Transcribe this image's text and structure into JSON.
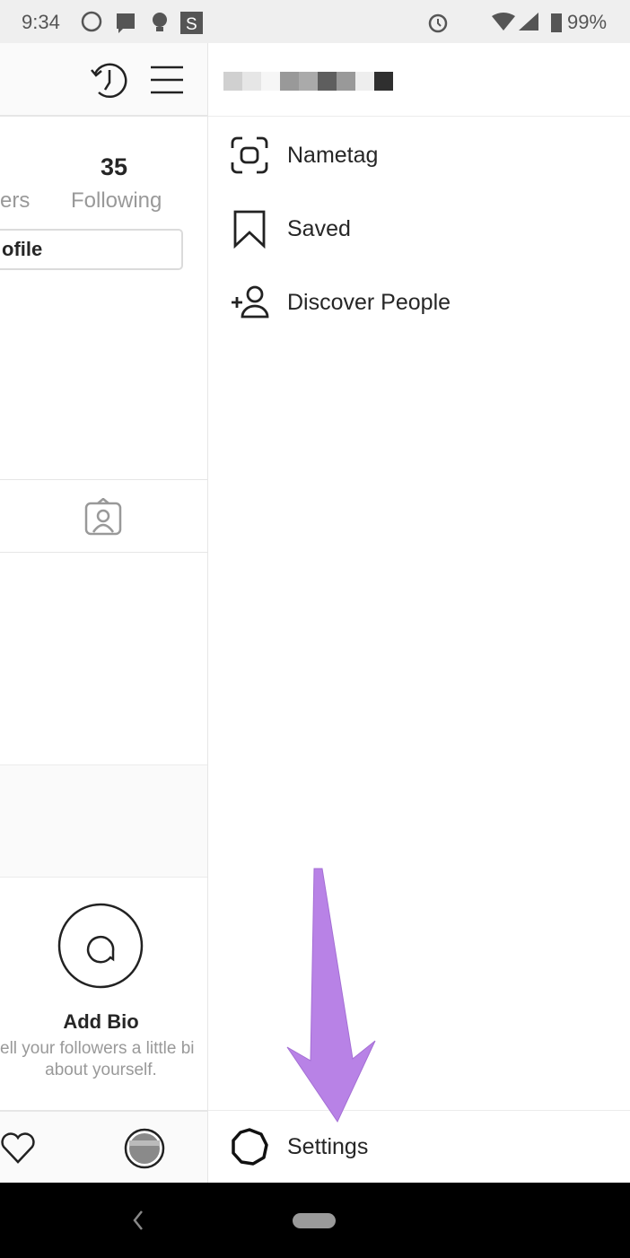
{
  "status_bar": {
    "time": "9:34",
    "battery": "99%",
    "icons": [
      "whatsapp-icon",
      "message-icon",
      "bulb-icon",
      "s-app-icon",
      "dot-icon",
      "alarm-icon",
      "wifi-icon",
      "signal-icon",
      "battery-icon"
    ]
  },
  "profile": {
    "followers_partial": "ers",
    "following_count": "35",
    "following_label": "Following",
    "edit_profile_partial": "ofile",
    "add_bio_title": "Add Bio",
    "add_bio_line1": "ell your followers a little bi",
    "add_bio_line2": "about yourself."
  },
  "menu": {
    "items": [
      {
        "label": "Nametag",
        "icon": "nametag-icon"
      },
      {
        "label": "Saved",
        "icon": "bookmark-icon"
      },
      {
        "label": "Discover People",
        "icon": "add-person-icon"
      }
    ],
    "settings_label": "Settings"
  },
  "annotation": {
    "arrow_color": "#b882e6"
  }
}
